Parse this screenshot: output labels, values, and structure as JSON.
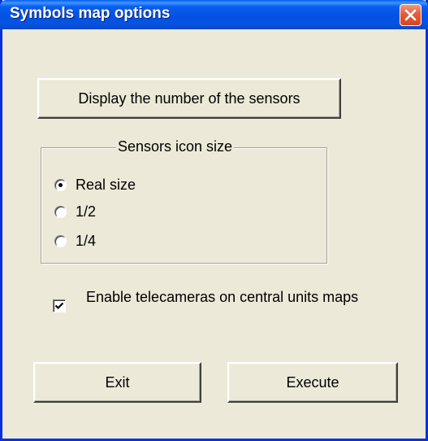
{
  "window": {
    "title": "Symbols map options"
  },
  "buttons": {
    "display_sensors_label": "Display the number of the sensors",
    "exit_label": "Exit",
    "execute_label": "Execute"
  },
  "icon_size_group": {
    "title": "Sensors icon size",
    "options": [
      {
        "label": "Real size",
        "checked": true
      },
      {
        "label": "1/2",
        "checked": false
      },
      {
        "label": "1/4",
        "checked": false
      }
    ]
  },
  "telecameras": {
    "label": "Enable telecameras on central units maps",
    "checked": true
  },
  "icons": {
    "close": "close-icon",
    "check": "checkmark-icon"
  },
  "colors": {
    "titlebar": "#0452e3",
    "close_button": "#e35d3a",
    "dialog_background": "#ece9d8"
  }
}
